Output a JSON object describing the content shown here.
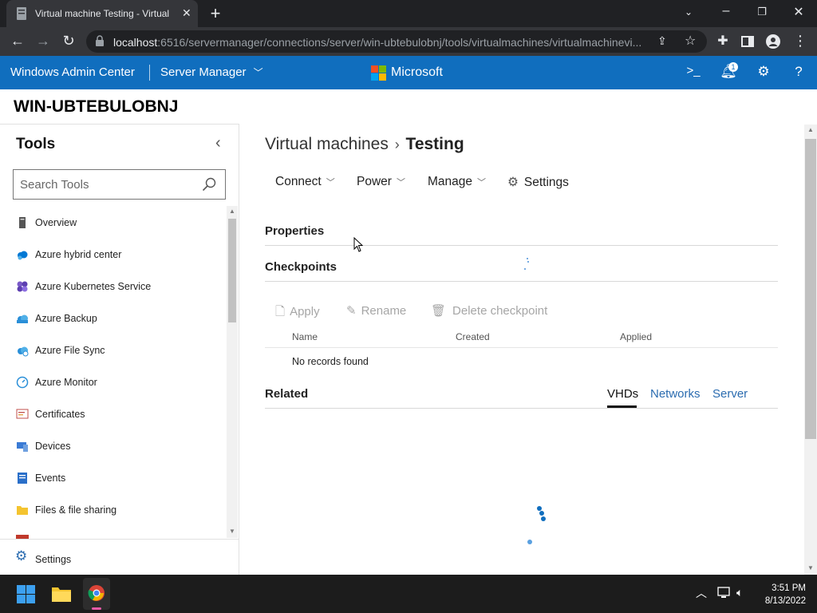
{
  "browser": {
    "tab_title": "Virtual machine Testing - Virtual m",
    "tab_close": "✕",
    "new_tab": "+",
    "url_host": "localhost",
    "url_rest": ":6516/servermanager/connections/server/win-ubtebulobnj/tools/virtualmachines/virtualmachinevi..."
  },
  "header": {
    "brand": "Windows Admin Center",
    "product": "Server Manager",
    "company": "Microsoft",
    "notification_count": "1"
  },
  "server": {
    "name": "WIN-UBTEBULOBNJ"
  },
  "tools": {
    "title": "Tools",
    "search_placeholder": "Search Tools",
    "items": [
      {
        "label": "Overview",
        "icon": "server-icon"
      },
      {
        "label": "Azure hybrid center",
        "icon": "cloud-icon"
      },
      {
        "label": "Azure Kubernetes Service",
        "icon": "kubernetes-icon"
      },
      {
        "label": "Azure Backup",
        "icon": "cloud-backup-icon"
      },
      {
        "label": "Azure File Sync",
        "icon": "cloud-sync-icon"
      },
      {
        "label": "Azure Monitor",
        "icon": "gauge-icon"
      },
      {
        "label": "Certificates",
        "icon": "certificate-icon"
      },
      {
        "label": "Devices",
        "icon": "devices-icon"
      },
      {
        "label": "Events",
        "icon": "events-icon"
      },
      {
        "label": "Files & file sharing",
        "icon": "folder-icon"
      }
    ],
    "settings_label": "Settings"
  },
  "main": {
    "breadcrumb_parent": "Virtual machines",
    "breadcrumb_current": "Testing",
    "commands": {
      "connect": "Connect",
      "power": "Power",
      "manage": "Manage",
      "settings": "Settings"
    },
    "sections": {
      "properties": "Properties",
      "checkpoints": "Checkpoints",
      "related": "Related"
    },
    "checkpoint_actions": {
      "apply": "Apply",
      "rename": "Rename",
      "delete": "Delete checkpoint"
    },
    "columns": {
      "name": "Name",
      "created": "Created",
      "applied": "Applied"
    },
    "empty_text": "No records found",
    "related_tabs": {
      "vhds": "VHDs",
      "networks": "Networks",
      "server": "Server"
    }
  },
  "taskbar": {
    "time": "3:51 PM",
    "date": "8/13/2022"
  },
  "colors": {
    "accent": "#106ebe",
    "link": "#2b6cb0",
    "disabled": "#a6a6a6"
  }
}
